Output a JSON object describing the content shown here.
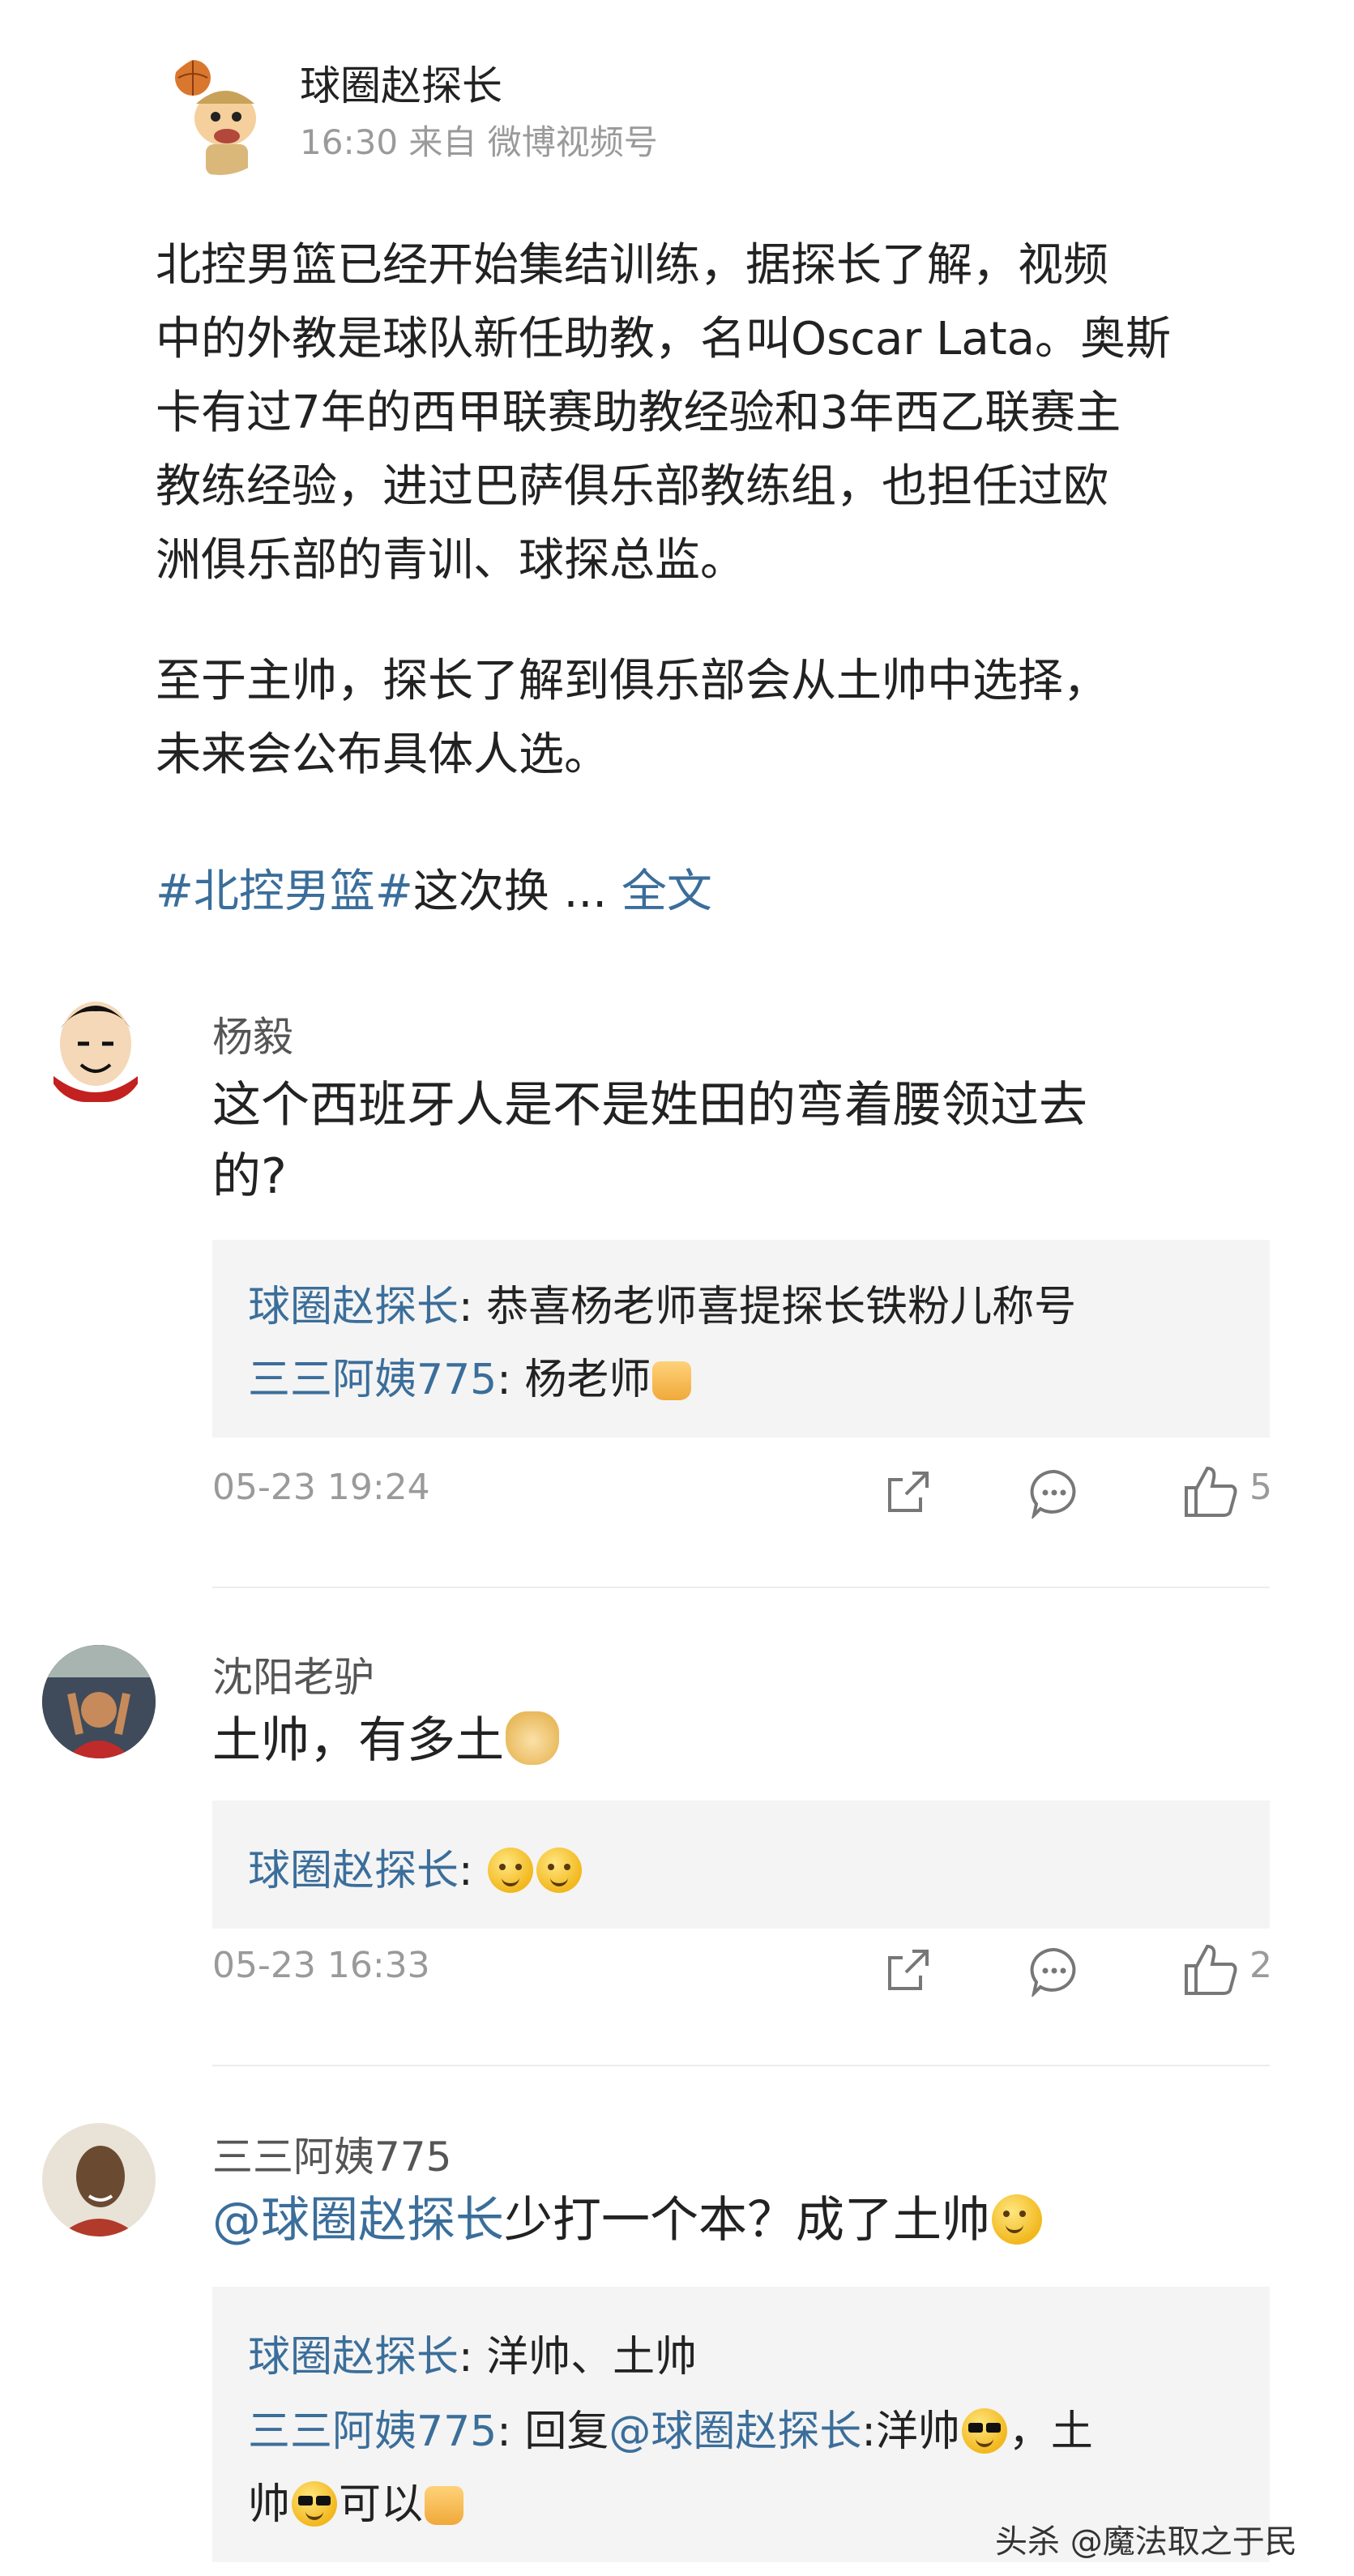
{
  "post": {
    "author": "球圈赵探长",
    "time": "16:30",
    "source": "来自 微博视频号",
    "paragraph1_lines": [
      "北控男篮已经开始集结训练，据探长了解，视频",
      "中的外教是球队新任助教，名叫Oscar Lata。奥斯",
      "卡有过7年的西甲联赛助教经验和3年西乙联赛主",
      "教练经验，进过巴萨俱乐部教练组，也担任过欧",
      "洲俱乐部的青训、球探总监。"
    ],
    "paragraph2_lines": [
      "至于主帅，探长了解到俱乐部会从土帅中选择，",
      "未来会公布具体人选。"
    ],
    "hashtag": "#北控男篮#",
    "hashtag_tail": "这次换 ...",
    "full_text_link": "全文"
  },
  "comments": [
    {
      "user": "杨毅",
      "text_line1": "这个西班牙人是不是姓田的弯着腰领过去",
      "text_line2": "的?",
      "replies": [
        {
          "name": "球圈赵探长",
          "sep": ": ",
          "text": "恭喜杨老师喜提探长铁粉儿称号"
        },
        {
          "name": "三三阿姨775",
          "sep": ": ",
          "text": "杨老师"
        }
      ],
      "date": "05-23 19:24",
      "likes": "5"
    },
    {
      "user": "沈阳老驴",
      "text": "土帅，有多土",
      "replies": [
        {
          "name": "球圈赵探长",
          "sep": ": "
        }
      ],
      "date": "05-23 16:33",
      "likes": "2"
    },
    {
      "user": "三三阿姨775",
      "mention": "@球圈赵探长",
      "text": "少打一个本？成了土帅",
      "replies": [
        {
          "name": "球圈赵探长",
          "sep": ": ",
          "text": "洋帅、土帅"
        },
        {
          "name": "三三阿姨775",
          "sep": ": ",
          "prefix": "回复",
          "mention": "@球圈赵探长",
          "text_a": ":洋帅",
          "text_b": "，土",
          "text_c": "帅",
          "text_d": "可以"
        }
      ]
    }
  ],
  "watermark": "头杀 @魔法取之于民",
  "colors": {
    "link": "#3b6e9a",
    "meta": "#9a9a9a",
    "reply_bg": "#f4f4f4",
    "divider": "#ececec"
  }
}
